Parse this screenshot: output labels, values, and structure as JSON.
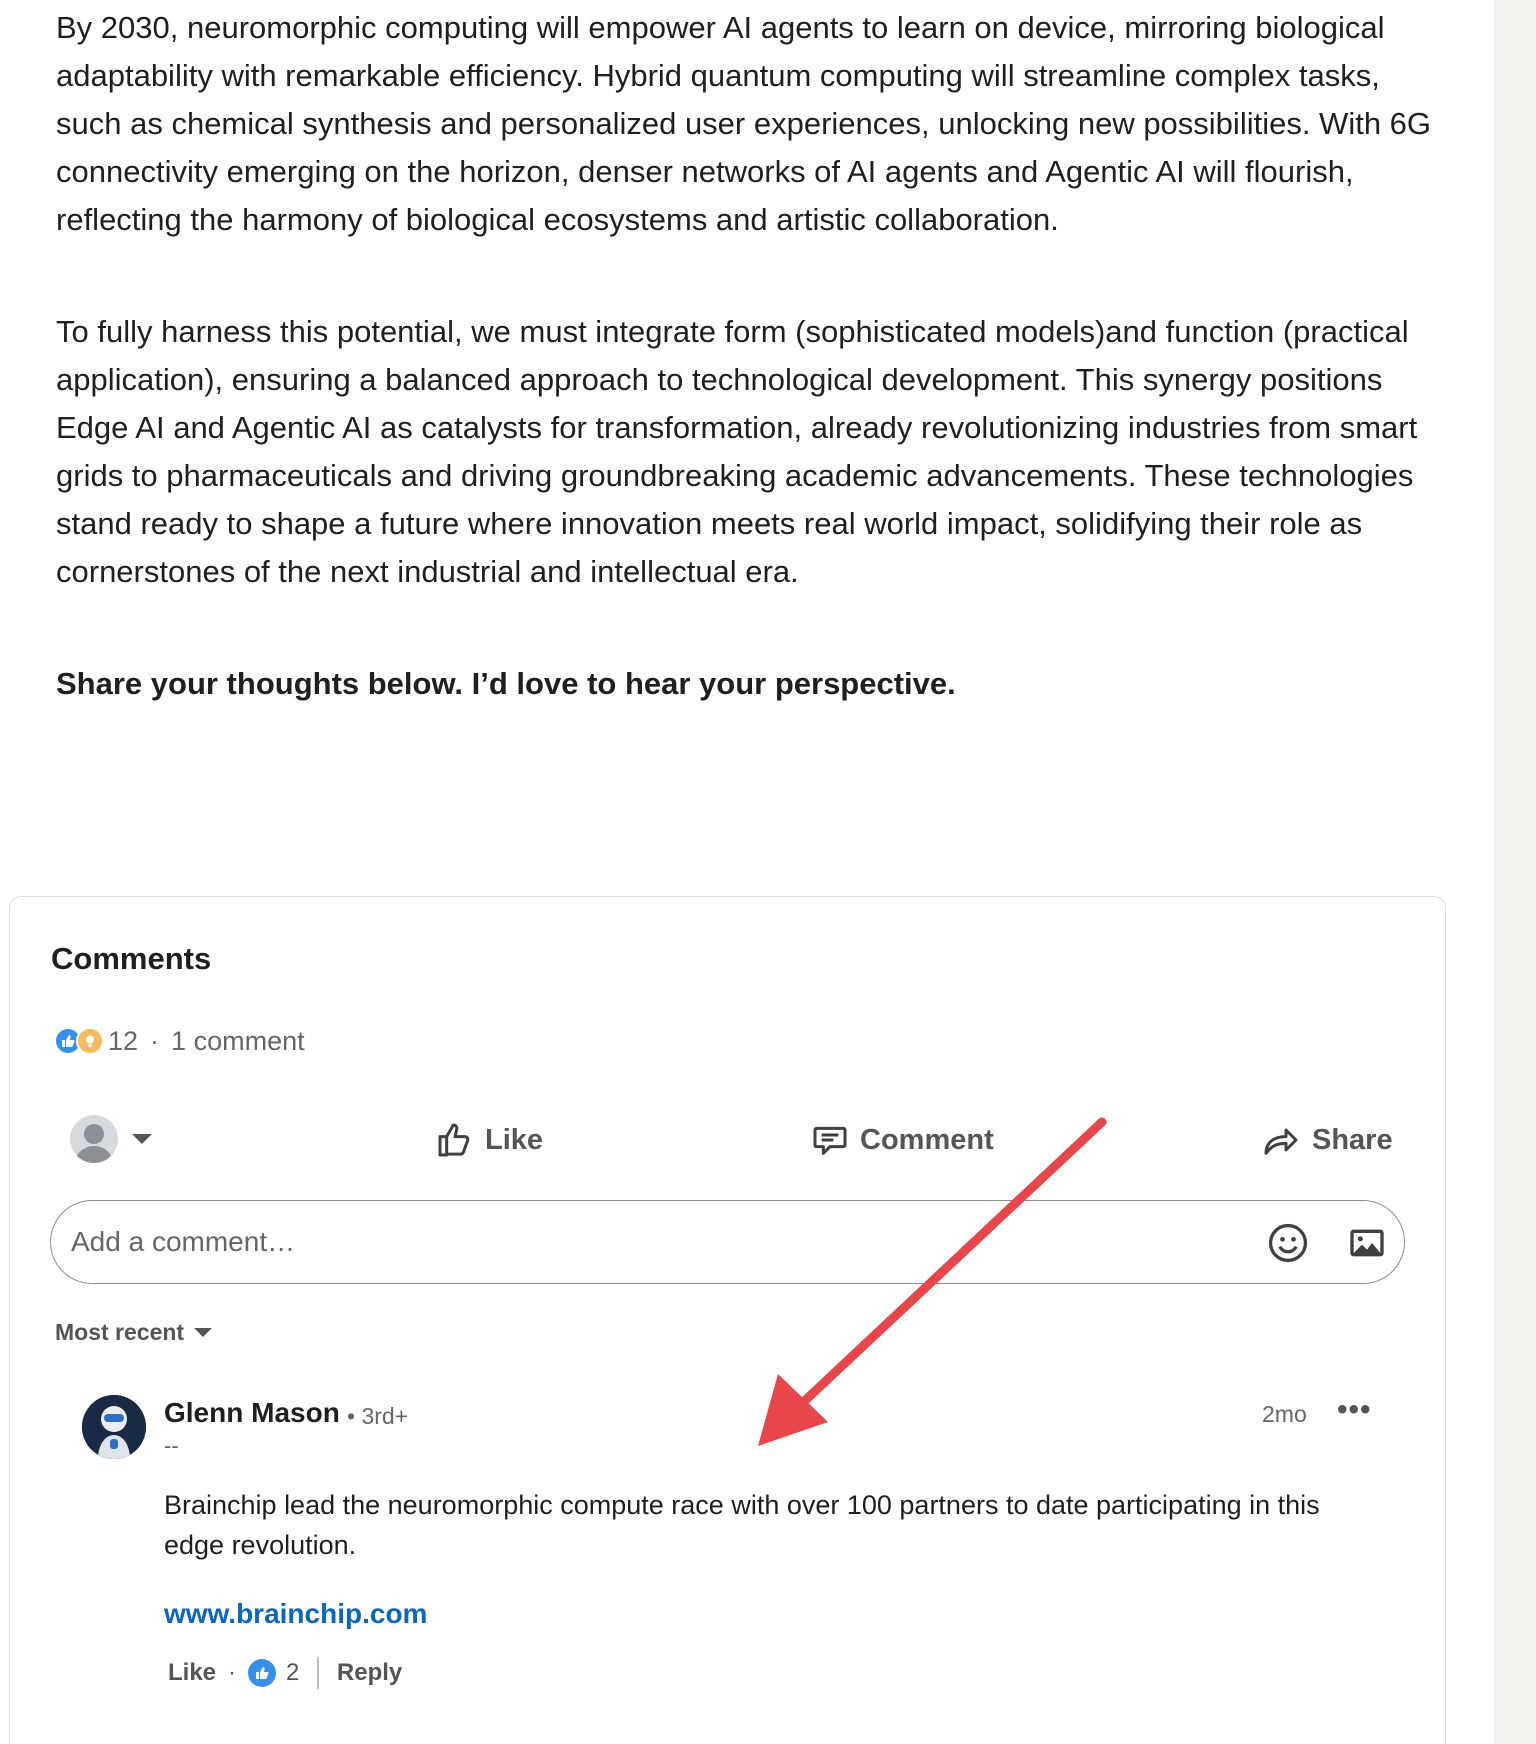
{
  "article": {
    "paragraph1": "By 2030, neuromorphic computing will empower AI agents to learn on device, mirroring biological adaptability with remarkable efficiency. Hybrid quantum computing will streamline complex tasks, such as chemical synthesis and personalized user experiences, unlocking new possibilities. With 6G connectivity emerging on the horizon, denser networks of AI agents and Agentic AI will flourish, reflecting the harmony of biological ecosystems and artistic collaboration.",
    "paragraph2": "To fully harness this potential, we must integrate form (sophisticated models)and function (practical application), ensuring a balanced approach to technological development. This synergy positions Edge AI and Agentic AI as catalysts for transformation, already revolutionizing industries from smart grids to pharmaceuticals and driving groundbreaking academic advancements. These technologies stand ready to shape a future where innovation meets real world impact, solidifying their role as cornerstones of the next industrial and intellectual era.",
    "closing": "Share your thoughts below. I’d love to hear your perspective."
  },
  "comments_section": {
    "title": "Comments",
    "reaction_count": "12",
    "separator": "·",
    "comment_count": "1 comment",
    "reaction_icons": [
      "like-icon",
      "insightful-icon"
    ]
  },
  "actions": {
    "like_label": "Like",
    "comment_label": "Comment",
    "share_label": "Share"
  },
  "comment_box": {
    "placeholder": "Add a comment…",
    "emoji_icon": "emoji-icon",
    "image_icon": "image-icon"
  },
  "sort": {
    "label": "Most recent"
  },
  "comments": [
    {
      "author": "Glenn Mason",
      "degree": "• 3rd+",
      "headline": "--",
      "time": "2mo",
      "more": "•••",
      "text": "Brainchip lead the neuromorphic compute race with over 100 partners to date participating in this edge revolution.",
      "link": "www.brainchip.com",
      "like_label": "Like",
      "dot": "·",
      "like_count": "2",
      "reply_label": "Reply"
    }
  ],
  "colors": {
    "link_blue": "#0a66c2",
    "like_blue": "#378fe9",
    "insight_gold": "#f5bb5c",
    "annotation_red": "#e8464a",
    "rail_gray": "#f3f2ef"
  }
}
